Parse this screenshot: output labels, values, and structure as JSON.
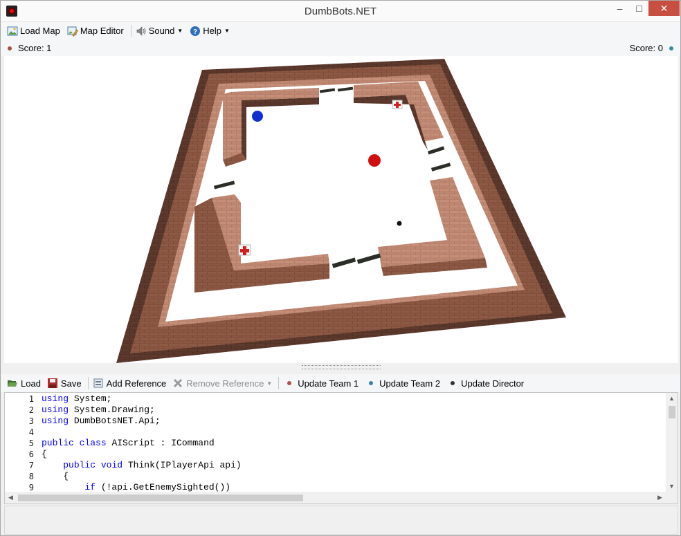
{
  "window": {
    "title": "DumbBots.NET"
  },
  "menu": {
    "load_map": "Load Map",
    "map_editor": "Map Editor",
    "sound": "Sound",
    "help": "Help"
  },
  "scores": {
    "team1": {
      "label": "Score: 1",
      "color": "#a0523c"
    },
    "team2": {
      "label": "Score: 0",
      "color": "#3a8a9a"
    }
  },
  "toolbar": {
    "load": "Load",
    "save": "Save",
    "add_reference": "Add Reference",
    "remove_reference": "Remove Reference",
    "update_team1": "Update Team 1",
    "update_team2": "Update Team 2",
    "update_director": "Update Director",
    "team1_color": "#b05050",
    "team2_color": "#3a7fbf",
    "director_color": "#333333"
  },
  "editor": {
    "line_numbers": [
      "1",
      "2",
      "3",
      "4",
      "5",
      "6",
      "7",
      "8",
      "9"
    ]
  },
  "scene": {
    "blue_bot_color": "#1030d0",
    "red_bot_color": "#d01010",
    "brick_color": "#8b5a45"
  }
}
